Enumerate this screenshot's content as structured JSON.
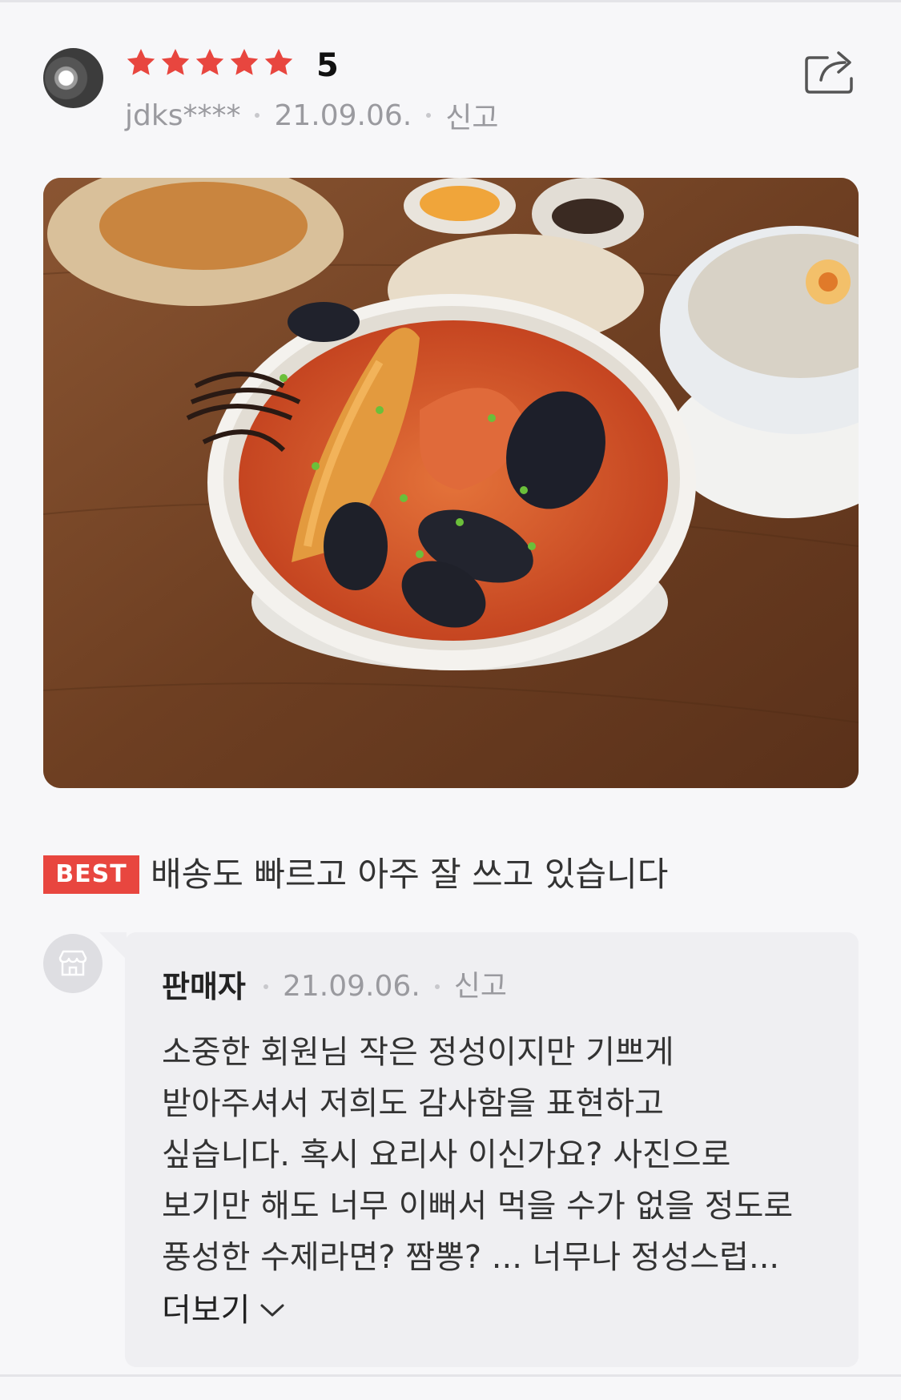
{
  "review": {
    "rating_value": "5",
    "stars_filled": 5,
    "username": "jdks****",
    "date": "21.09.06.",
    "report_label": "신고",
    "best_badge": "BEST",
    "text": "배송도 빠르고 아주 잘 쓰고 있습니다"
  },
  "seller_reply": {
    "name": "판매자",
    "date": "21.09.06.",
    "report_label": "신고",
    "lines": [
      "소중한 회원님 작은 정성이지만 기쁘게",
      "받아주셔서 저희도 감사함을 표현하고",
      "싶습니다. 혹시 요리사 이신가요? 사진으로",
      "보기만 해도 너무 이뻐서 먹을 수가 없을 정도로",
      "풍성한 수제라면? 짬뽕? ... 너무나 정성스럽..."
    ],
    "more_label": "더보기"
  },
  "colors": {
    "star": "#e8463f",
    "best_badge": "#e8463f",
    "meta_text": "#9a9a9f"
  },
  "icons": [
    "star-icon",
    "share-icon",
    "store-icon",
    "chevron-down-icon"
  ]
}
